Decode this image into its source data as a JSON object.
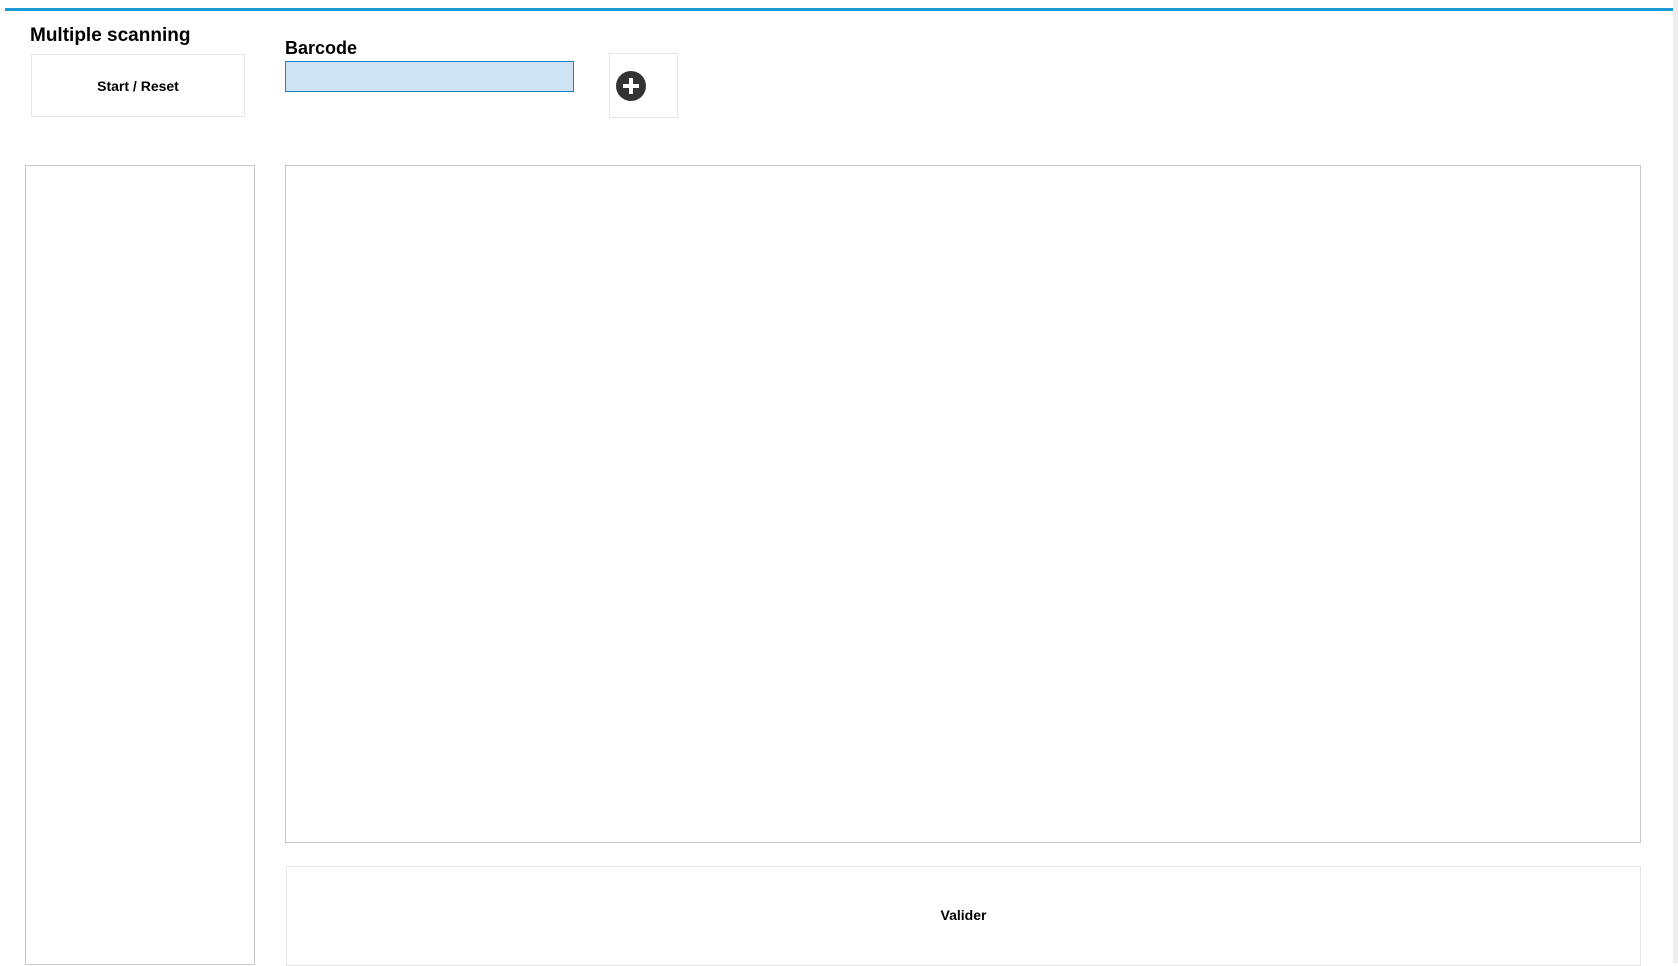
{
  "header": {
    "title": "Multiple scanning",
    "start_reset_label": "Start / Reset",
    "accent_color": "#1a9ad6"
  },
  "barcode": {
    "label": "Barcode",
    "value": "",
    "placeholder": ""
  },
  "add_button": {
    "icon": "plus-circle-icon"
  },
  "footer": {
    "validate_label": "Valider"
  }
}
